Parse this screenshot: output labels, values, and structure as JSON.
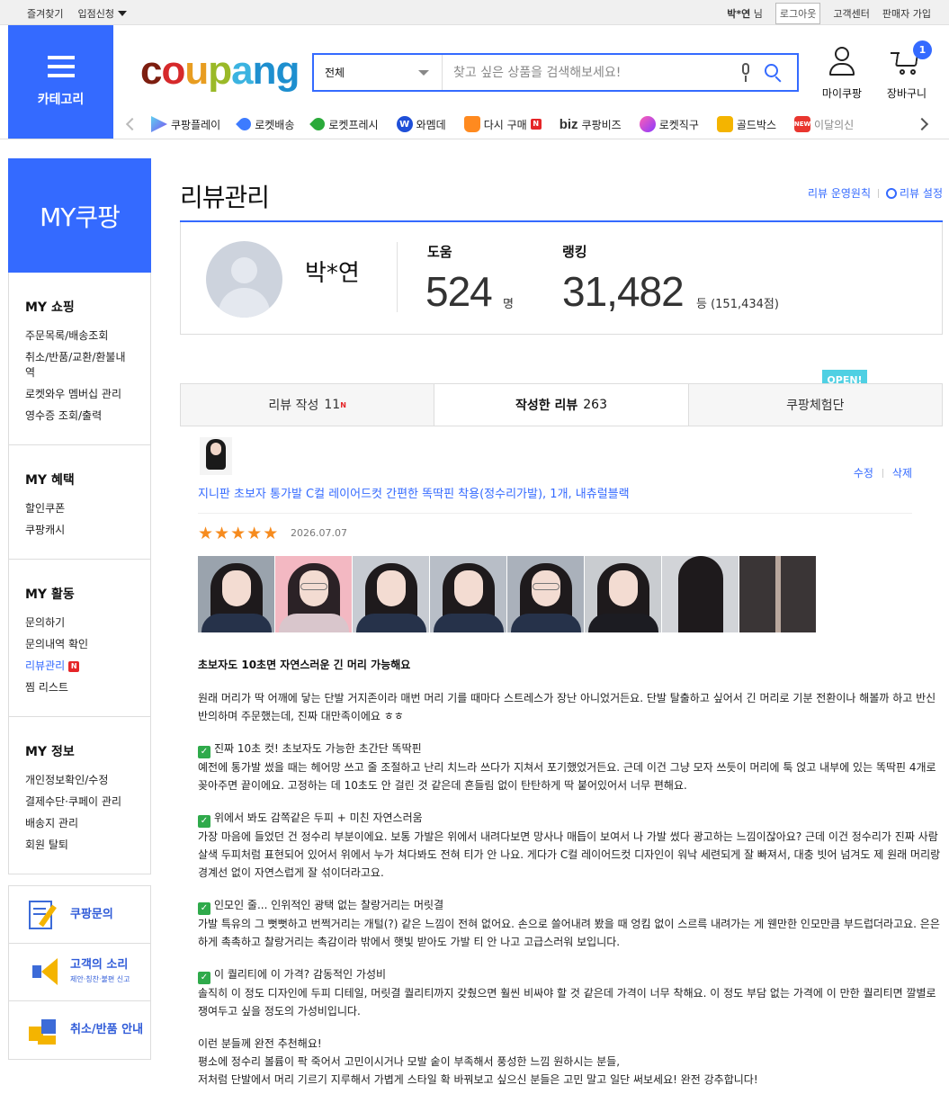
{
  "topbar": {
    "bookmark": "즐겨찾기",
    "seller_apply": "입점신청",
    "user_name": "박*연",
    "user_suffix": "님",
    "logout": "로그아웃",
    "customer_center": "고객센터",
    "seller_join": "판매자 가입"
  },
  "header": {
    "category_label": "카테고리",
    "logo": [
      "c",
      "o",
      "u",
      "p",
      "a",
      "ng"
    ],
    "search_scope": "전체",
    "search_placeholder": "찾고 싶은 상품을 검색해보세요!",
    "mycoupang_label": "마이쿠팡",
    "cart_label": "장바구니",
    "cart_count": "1",
    "brand_colors": {
      "primary": "#346aff"
    }
  },
  "shortcuts": [
    {
      "label": "쿠팡플레이",
      "icon": "play-icon"
    },
    {
      "label": "로켓배송",
      "icon": "rocket-icon"
    },
    {
      "label": "로켓프레시",
      "icon": "rocket-fresh-icon"
    },
    {
      "label": "와멤데",
      "icon": "wow-icon"
    },
    {
      "label": "다시 구매",
      "icon": "basket-icon",
      "badge": "N"
    },
    {
      "label": "쿠팡비즈",
      "icon": "biz-icon",
      "prefix": "biz"
    },
    {
      "label": "로켓직구",
      "icon": "global-rocket-icon"
    },
    {
      "label": "골드박스",
      "icon": "goldbox-icon"
    },
    {
      "label": "이달의신",
      "icon": "new-bag-icon"
    }
  ],
  "sidebar": {
    "title": "MY쿠팡",
    "groups": [
      {
        "title": "MY 쇼핑",
        "items": [
          "주문목록/배송조회",
          "취소/반품/교환/환불내역",
          "로켓와우 멤버십 관리",
          "영수증 조회/출력"
        ]
      },
      {
        "title": "MY 혜택",
        "items": [
          "할인쿠폰",
          "쿠팡캐시"
        ]
      },
      {
        "title": "MY 활동",
        "items": [
          "문의하기",
          "문의내역 확인",
          "리뷰관리",
          "찜 리스트"
        ],
        "active": "리뷰관리",
        "active_badge": "N"
      },
      {
        "title": "MY 정보",
        "items": [
          "개인정보확인/수정",
          "결제수단·쿠페이 관리",
          "배송지 관리",
          "회원 탈퇴"
        ]
      }
    ],
    "banners": [
      {
        "title": "쿠팡문의",
        "sub": ""
      },
      {
        "title": "고객의 소리",
        "sub": "제안·칭찬·불편 신고"
      },
      {
        "title": "취소/반품 안내",
        "sub": ""
      }
    ]
  },
  "page": {
    "title": "리뷰관리",
    "link_policy": "리뷰 운영원칙",
    "link_settings": "리뷰 설정"
  },
  "profile": {
    "name": "박*연",
    "help_label": "도움",
    "help_value": "524",
    "help_unit": "명",
    "rank_label": "랭킹",
    "rank_value": "31,482",
    "rank_unit": "등 (151,434점)"
  },
  "tabs": [
    {
      "label": "리뷰 작성",
      "count": "11",
      "badge": "N"
    },
    {
      "label": "작성한 리뷰",
      "count": "263",
      "active": true
    },
    {
      "label": "쿠팡체험단",
      "count": ""
    }
  ],
  "open_badge": "OPEN!",
  "review": {
    "product_name": "지니판 초보자 통가발 C컬 레이어드컷 간편한 똑딱핀 착용(정수리가발), 1개, 내츄럴블랙",
    "edit": "수정",
    "delete": "삭제",
    "rating": 5,
    "date": "2026.07.07",
    "photo_count": 8,
    "headline": "초보자도 10초면 자연스러운 긴 머리 가능해요",
    "paragraphs": [
      {
        "check": false,
        "heading": "",
        "text": "원래 머리가 딱 어깨에 닿는 단발 거지존이라 매번 머리 기를 때마다 스트레스가 장난 아니었거든요. 단발 탈출하고 싶어서 긴 머리로 기분 전환이나 해볼까 하고 반신반의하며 주문했는데, 진짜 대만족이에요 ㅎㅎ"
      },
      {
        "check": true,
        "heading": "진짜 10초 컷! 초보자도 가능한 초간단 똑딱핀",
        "text": "예전에 통가발 썼을 때는 헤어망 쓰고 줄 조절하고 난리 치느라 쓰다가 지쳐서 포기했었거든요. 근데 이건 그냥 모자 쓰듯이 머리에 툭 얹고 내부에 있는 똑딱핀 4개로 꽂아주면 끝이에요. 고정하는 데 10초도 안 걸린 것 같은데 흔들림 없이 탄탄하게 딱 붙어있어서 너무 편해요."
      },
      {
        "check": true,
        "heading": "위에서 봐도 감쪽같은 두피 + 미친 자연스러움",
        "text": "가장 마음에 들었던 건 정수리 부분이에요. 보통 가발은 위에서 내려다보면 망사나 매듭이 보여서 나 가발 썼다 광고하는 느낌이잖아요? 근데 이건 정수리가 진짜 사람 살색 두피처럼 표현되어 있어서 위에서 누가 쳐다봐도 전혀 티가 안 나요. 게다가 C컬 레이어드컷 디자인이 워낙 세련되게 잘 빠져서, 대충 빗어 넘겨도 제 원래 머리랑 경계선 없이 자연스럽게 잘 섞이더라고요."
      },
      {
        "check": true,
        "heading": "인모인 줄... 인위적인 광택 없는 찰랑거리는 머릿결",
        "text": "가발 특유의 그 뻣뻣하고 번쩍거리는 개털(?) 같은 느낌이 전혀 없어요. 손으로 쓸어내려 봤을 때 엉킴 없이 스르륵 내려가는 게 웬만한 인모만큼 부드럽더라고요. 은은하게 촉촉하고 찰랑거리는 촉감이라 밖에서 햇빛 받아도 가발 티 안 나고 고급스러워 보입니다."
      },
      {
        "check": true,
        "heading": "이 퀄리티에 이 가격? 감동적인 가성비",
        "text": "솔직히 이 정도 디자인에 두피 디테일, 머릿결 퀄리티까지 갖췄으면 훨씬 비싸야 할 것 같은데 가격이 너무 착해요. 이 정도 부담 없는 가격에 이 만한 퀄리티면 깔별로 쟁여두고 싶을 정도의 가성비입니다."
      },
      {
        "check": false,
        "heading": " 이런 분들께 완전 추천해요!",
        "text": "평소에 정수리 볼륨이 팍 죽어서 고민이시거나 모발 숱이 부족해서 풍성한 느낌 원하시는 분들,\n저처럼 단발에서 머리 기르기 지루해서 가볍게 스타일 확 바꿔보고 싶으신 분들은 고민 말고 일단 써보세요! 완전 강추합니다!"
      }
    ]
  }
}
